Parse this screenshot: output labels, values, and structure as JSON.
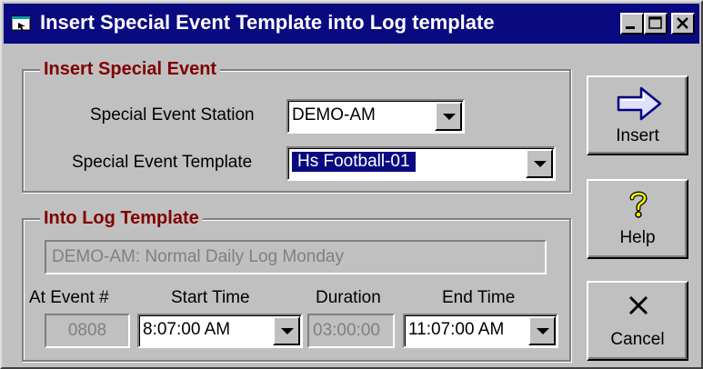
{
  "window": {
    "title": "Insert Special Event Template into Log template"
  },
  "insert_group": {
    "legend": "Insert Special Event",
    "station_label": "Special Event Station",
    "station_value": "DEMO-AM",
    "template_label": "Special Event Template",
    "template_value": "Hs Football-01"
  },
  "log_group": {
    "legend": "Into Log Template",
    "log_template_value": "DEMO-AM: Normal Daily Log Monday",
    "at_event_label": "At Event #",
    "start_time_label": "Start Time",
    "duration_label": "Duration",
    "end_time_label": "End Time",
    "at_event_value": "0808",
    "start_time_value": "8:07:00 AM",
    "duration_value": "03:00:00",
    "end_time_value": "11:07:00 AM"
  },
  "buttons": {
    "insert": "Insert",
    "help": "Help",
    "cancel": "Cancel"
  },
  "colors": {
    "titlebar": "#0a0a80",
    "legend_text": "#800000",
    "face": "#c0c0c0"
  }
}
